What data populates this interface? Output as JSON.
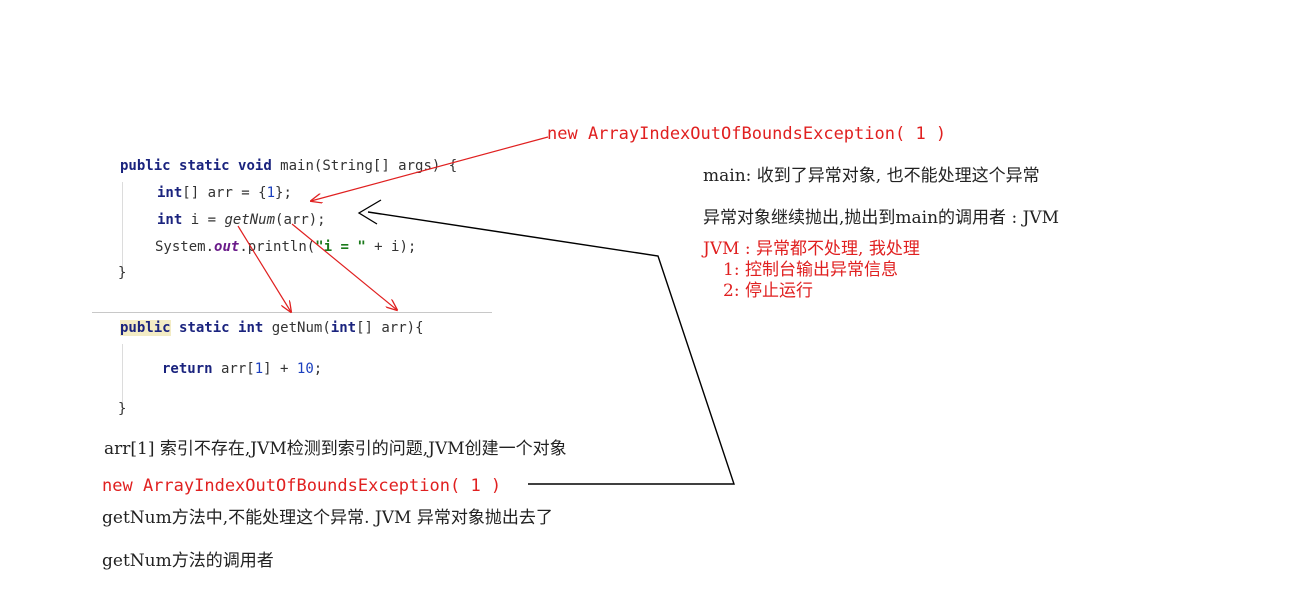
{
  "code": {
    "main_sig": {
      "kw1": "public",
      "kw2": "static",
      "kw3": "void",
      "rest": " main(String[] args) {"
    },
    "line_arr": {
      "kw": "int",
      "mid": "[] arr = {",
      "num": "1",
      "end": "};"
    },
    "line_i": {
      "kw": "int",
      "mid": " i = ",
      "call": "getNum",
      "end": "(arr);"
    },
    "line_print": {
      "pre": "System.",
      "out": "out",
      "mid": ".println(",
      "str": "\"i = \"",
      "end": " + i);"
    },
    "close1": "}",
    "getnum_sig": {
      "kw1": "public",
      "kw2": "static",
      "kw3": "int",
      "mid": " getNum(",
      "kw4": "int",
      "end": "[] arr){"
    },
    "line_return": {
      "kw": "return",
      "mid": " arr[",
      "num1": "1",
      "mid2": "] + ",
      "num2": "10",
      "end": ";"
    },
    "close2": "}"
  },
  "notes": {
    "new_exception_top": "new ArrayIndexOutOfBoundsException( 1 )",
    "main_received": "main: 收到了异常对象, 也不能处理这个异常",
    "thrown_to_jvm": "异常对象继续抛出,抛出到main的调用者 : JVM",
    "jvm_handles": "JVM : 异常都不处理, 我处理",
    "jvm_step1": "1: 控制台输出异常信息",
    "jvm_step2": "2: 停止运行",
    "index_missing": "arr[1] 索引不存在,JVM检测到索引的问题,JVM创建一个对象",
    "new_exception_bottom": "new ArrayIndexOutOfBoundsException( 1 )",
    "getnum_cannot": "getNum方法中,不能处理这个异常. JVM 异常对象抛出去了",
    "getnum_caller": "getNum方法的调用者"
  },
  "colors": {
    "arrow_red": "#e02020",
    "line_black": "#000000",
    "keyword": "#1a237e",
    "string": "#1b7a1b",
    "number": "#1a3fbf"
  }
}
